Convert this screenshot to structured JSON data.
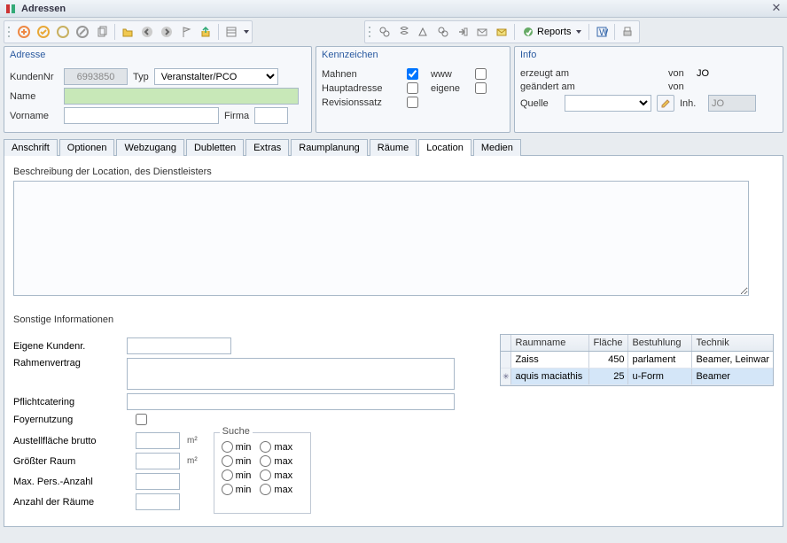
{
  "window": {
    "title": "Adressen"
  },
  "toolbar2": {
    "reports_label": "Reports"
  },
  "panelA": {
    "title": "Adresse",
    "kundennr_label": "KundenNr",
    "kundennr_value": "6993850",
    "typ_label": "Typ",
    "typ_value": "Veranstalter/PCO",
    "name_label": "Name",
    "name_value": "",
    "vorname_label": "Vorname",
    "vorname_value": "",
    "firma_label": "Firma"
  },
  "panelK": {
    "title": "Kennzeichen",
    "mahnen_label": "Mahnen",
    "mahnen_checked": true,
    "www_label": "www",
    "www_checked": false,
    "haupt_label": "Hauptadresse",
    "haupt_checked": false,
    "eigene_label": "eigene",
    "eigene_checked": false,
    "rev_label": "Revisionssatz",
    "rev_checked": false
  },
  "panelI": {
    "title": "Info",
    "erzeugt_label": "erzeugt am",
    "erzeugt_val": "",
    "von1_label": "von",
    "von1_val": "JO",
    "geaendert_label": "geändert am",
    "geaendert_val": "",
    "von2_label": "von",
    "von2_val": "",
    "quelle_label": "Quelle",
    "quelle_val": "",
    "inh_label": "Inh.",
    "inh_val": "JO"
  },
  "tabs": {
    "anschrift": "Anschrift",
    "optionen": "Optionen",
    "webzugang": "Webzugang",
    "dubletten": "Dubletten",
    "extras": "Extras",
    "raumplanung": "Raumplanung",
    "raeume": "Räume",
    "location": "Location",
    "medien": "Medien"
  },
  "location": {
    "desc_label": "Beschreibung der Location, des Dienstleisters",
    "desc_value": "",
    "sonstige_label": "Sonstige Informationen",
    "eigene_label": "Eigene Kundenr.",
    "eigene_value": "",
    "rahmen_label": "Rahmenvertrag",
    "rahmen_value": "",
    "pflicht_label": "Pflichtcatering",
    "pflicht_value": "",
    "foyer_label": "Foyernutzung",
    "foyer_checked": false,
    "austell_label": "Austellfläche brutto",
    "austell_value": "",
    "austell_unit": "m²",
    "groesster_label": "Größter Raum",
    "groesster_value": "",
    "groesster_unit": "m²",
    "maxpers_label": "Max. Pers.-Anzahl",
    "maxpers_value": "",
    "anzahl_label": "Anzahl der Räume",
    "anzahl_value": "",
    "suche_label": "Suche",
    "min_label": "min",
    "max_label": "max",
    "grid": {
      "headers": {
        "raumname": "Raumname",
        "flaeche": "Fläche",
        "bestuhlung": "Bestuhlung",
        "technik": "Technik"
      },
      "rows": [
        {
          "raumname": "Zaiss",
          "flaeche": "450",
          "bestuhlung": "parlament",
          "technik": "Beamer, Leinwar"
        },
        {
          "raumname": "aquis maciathis",
          "flaeche": "25",
          "bestuhlung": "u-Form",
          "technik": "Beamer"
        }
      ]
    }
  }
}
